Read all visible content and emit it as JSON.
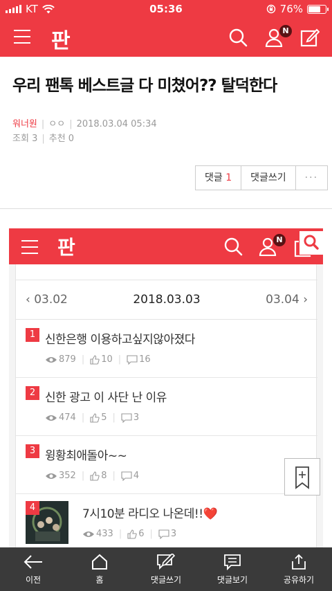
{
  "status_bar": {
    "carrier": "KT",
    "time": "05:36",
    "battery": "76%",
    "battery_level": 0.76
  },
  "header": {
    "logo": "판",
    "badge": "N"
  },
  "article": {
    "title": "우리 팬톡 베스트글 다 미쳤어?? 탈덕한다",
    "author": "워너원",
    "nickname": "ㅇㅇ",
    "datetime": "2018.03.04 05:34",
    "views_label": "조회",
    "views": "3",
    "recommend_label": "추천",
    "recommend": "0"
  },
  "actions": {
    "comment_label": "댓글",
    "comment_count": "1",
    "write_comment": "댓글쓰기",
    "more": "···"
  },
  "embedded": {
    "logo": "판",
    "badge": "N",
    "date_prev": "03.02",
    "date_current": "2018.03.03",
    "date_next": "03.04",
    "items": [
      {
        "rank": "1",
        "title": "신한은행 이용하고싶지않아졌다",
        "views": "879",
        "likes": "10",
        "comments": "16"
      },
      {
        "rank": "2",
        "title": "신한 광고 이 사단 난 이유",
        "views": "474",
        "likes": "5",
        "comments": "3"
      },
      {
        "rank": "3",
        "title": "윙황최애돌아~~",
        "views": "352",
        "likes": "8",
        "comments": "4"
      },
      {
        "rank": "4",
        "title": "7시10분 라디오 나온데!!❤️",
        "views": "433",
        "likes": "6",
        "comments": "3"
      }
    ]
  },
  "toolbar": [
    {
      "label": "이전",
      "icon": "back-arrow-icon"
    },
    {
      "label": "홈",
      "icon": "home-icon"
    },
    {
      "label": "댓글쓰기",
      "icon": "write-comment-icon"
    },
    {
      "label": "댓글보기",
      "icon": "view-comments-icon"
    },
    {
      "label": "공유하기",
      "icon": "share-icon"
    }
  ],
  "colors": {
    "brand": "#ee3a43",
    "toolbar": "#3a3a3a",
    "badge": "#5a1214"
  }
}
